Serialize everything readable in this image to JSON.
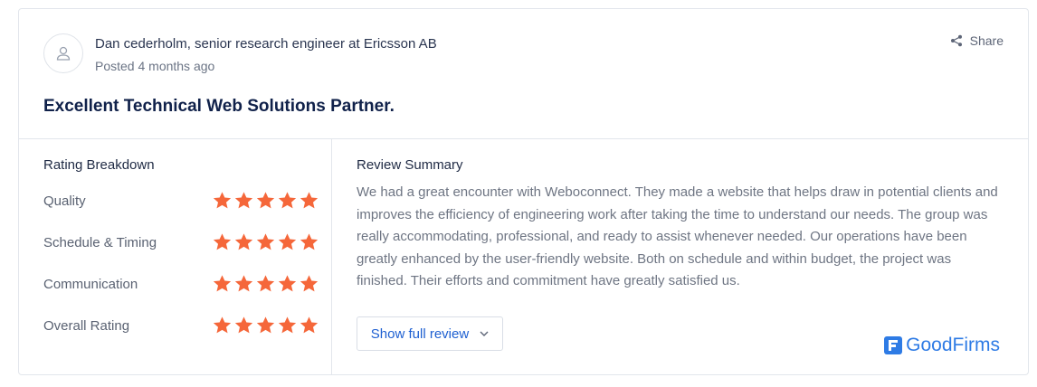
{
  "review": {
    "author": "Dan cederholm, senior research engineer at Ericsson AB",
    "posted": "Posted 4 months ago",
    "share_label": "Share",
    "headline": "Excellent Technical Web Solutions Partner."
  },
  "ratings": {
    "title": "Rating Breakdown",
    "items": [
      {
        "label": "Quality",
        "stars": 5
      },
      {
        "label": "Schedule & Timing",
        "stars": 5
      },
      {
        "label": "Communication",
        "stars": 5
      },
      {
        "label": "Overall Rating",
        "stars": 5
      }
    ],
    "max_stars": 5
  },
  "summary": {
    "title": "Review Summary",
    "text": "We had a great encounter with Weboconnect. They made a website that helps draw in potential clients and improves the efficiency of engineering work after taking the time to understand our needs. The group was really accommodating, professional, and ready to assist whenever needed. Our operations have been greatly enhanced by the user-friendly website. Both on schedule and within budget, the project was finished. Their efforts and commitment have greatly satisfied us.",
    "show_full_label": "Show full review"
  },
  "brand": {
    "name": "GoodFirms"
  },
  "colors": {
    "star": "#f5673a",
    "accent": "#1d5fd1",
    "brand": "#2e7be5"
  },
  "icons": {
    "avatar": "user-icon",
    "share": "share-icon",
    "chevron": "chevron-down-icon",
    "star": "star-icon",
    "logo": "goodfirms-logo-icon"
  }
}
